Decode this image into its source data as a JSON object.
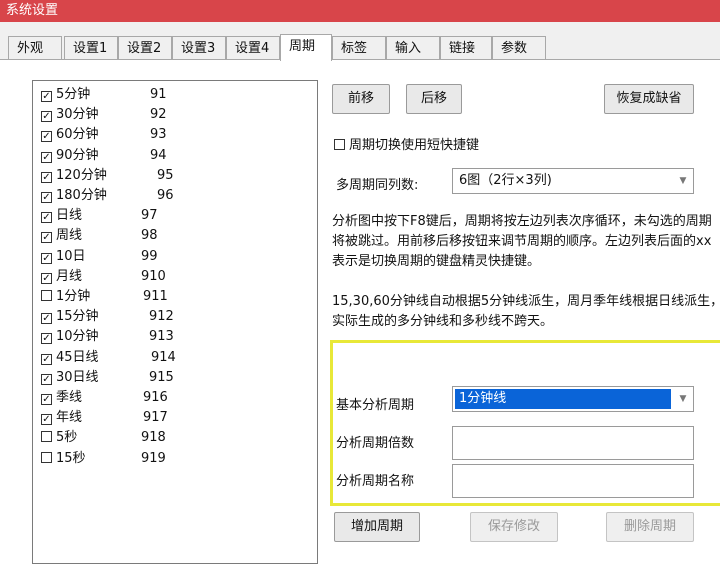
{
  "window": {
    "title": "系统设置"
  },
  "tabs": [
    {
      "label": "外观"
    },
    {
      "label": "设置1"
    },
    {
      "label": "设置2"
    },
    {
      "label": "设置3"
    },
    {
      "label": "设置4"
    },
    {
      "label": "周期"
    },
    {
      "label": "标签"
    },
    {
      "label": "输入"
    },
    {
      "label": "链接"
    },
    {
      "label": "参数"
    }
  ],
  "period_list": [
    {
      "label": "5分钟",
      "code": "91",
      "checked": true
    },
    {
      "label": "30分钟",
      "code": "92",
      "checked": true
    },
    {
      "label": "60分钟",
      "code": "93",
      "checked": true
    },
    {
      "label": "90分钟",
      "code": "94",
      "checked": true
    },
    {
      "label": "120分钟",
      "code": "95",
      "checked": true
    },
    {
      "label": "180分钟",
      "code": "96",
      "checked": true
    },
    {
      "label": "日线",
      "code": "97",
      "checked": true
    },
    {
      "label": "周线",
      "code": "98",
      "checked": true
    },
    {
      "label": "10日",
      "code": "99",
      "checked": true
    },
    {
      "label": "月线",
      "code": "910",
      "checked": true
    },
    {
      "label": "1分钟",
      "code": "911",
      "checked": false
    },
    {
      "label": "15分钟",
      "code": "912",
      "checked": true
    },
    {
      "label": "10分钟",
      "code": "913",
      "checked": true
    },
    {
      "label": "45日线",
      "code": "914",
      "checked": true
    },
    {
      "label": "30日线",
      "code": "915",
      "checked": true
    },
    {
      "label": "季线",
      "code": "916",
      "checked": true
    },
    {
      "label": "年线",
      "code": "917",
      "checked": true
    },
    {
      "label": "5秒",
      "code": "918",
      "checked": false
    },
    {
      "label": "15秒",
      "code": "919",
      "checked": false
    }
  ],
  "buttons": {
    "move_up": "前移",
    "move_down": "后移",
    "restore_default": "恢复成缺省",
    "add_period": "增加周期",
    "save_changes": "保存修改",
    "delete_period": "删除周期"
  },
  "shortcut_option": {
    "label": "周期切换使用短快捷键",
    "checked": false
  },
  "multi_period": {
    "label": "多周期同列数:",
    "value": "6图（2行×3列)"
  },
  "description": {
    "para1": [
      "分析图中按下F8键后，周期将按左边列表次序循环，未勾选的周期",
      "将被跳过。用前移后移按钮来调节周期的顺序。左边列表后面的xx",
      "表示是切换周期的键盘精灵快捷键。"
    ],
    "para2": [
      "15,30,60分钟线自动根据5分钟线派生，周月季年线根据日线派生，",
      "实际生成的多分钟线和多秒线不跨天。"
    ]
  },
  "form": {
    "base_period_label": "基本分析周期",
    "base_period_value": "1分钟线",
    "multiplier_label": "分析周期倍数",
    "multiplier_value": "",
    "name_label": "分析周期名称",
    "name_value": ""
  },
  "colors": {
    "titlebar": "#d8454a",
    "highlight": "#e8e838",
    "selection": "#0a64d8"
  }
}
